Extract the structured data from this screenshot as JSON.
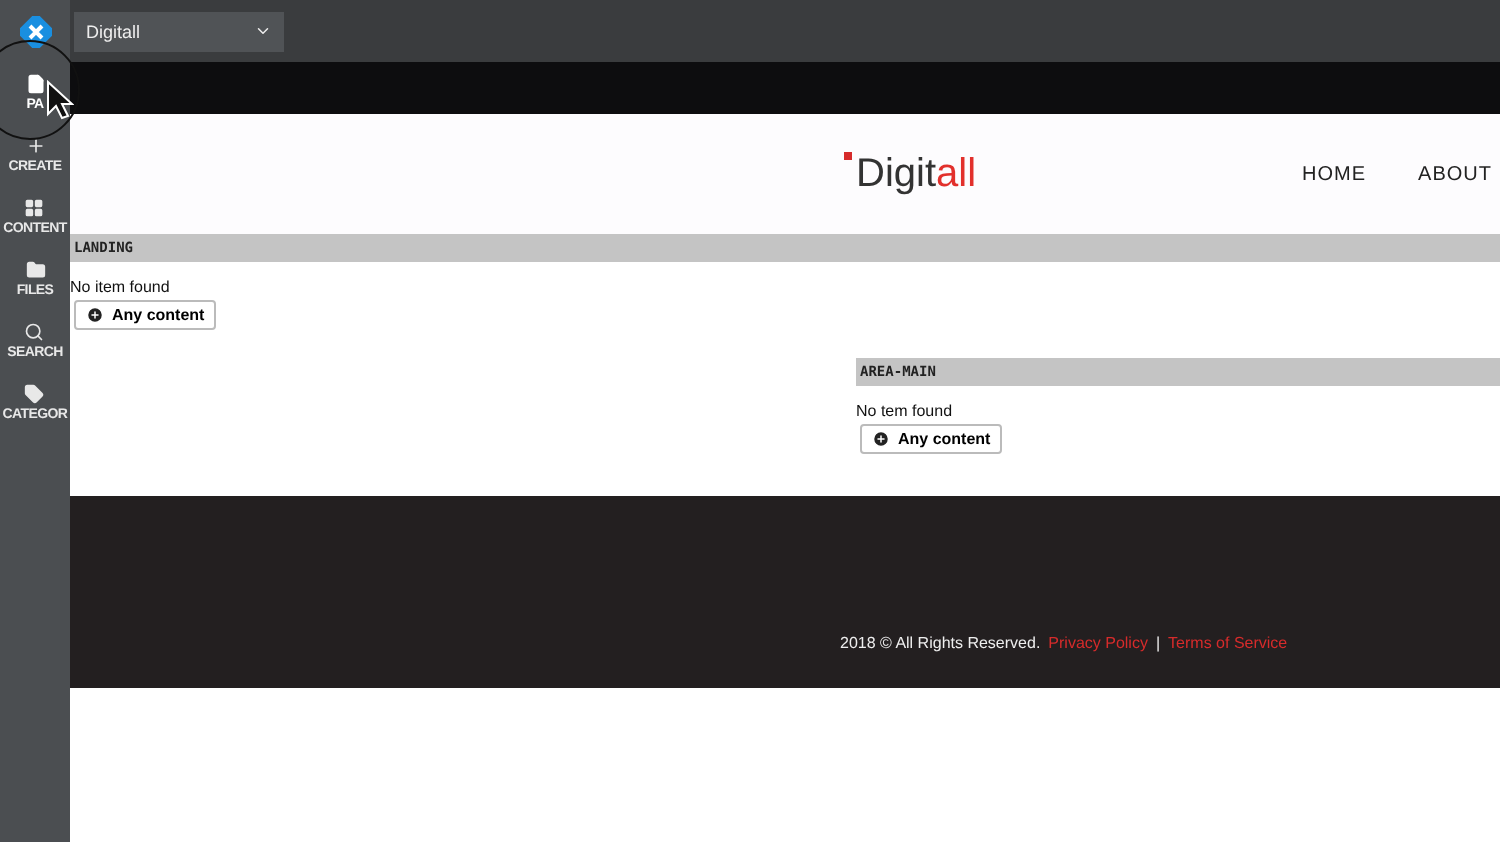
{
  "site_selector": {
    "value": "Digitall"
  },
  "sidebar": {
    "items": [
      {
        "label": "PA",
        "selected": true
      },
      {
        "label": "CREATE",
        "selected": false
      },
      {
        "label": "CONTENT",
        "selected": false
      },
      {
        "label": "FILES",
        "selected": false
      },
      {
        "label": "SEARCH",
        "selected": false
      },
      {
        "label": "CATEGOR",
        "selected": false
      }
    ]
  },
  "header": {
    "logo": {
      "dark": "Digit",
      "accent": "all"
    },
    "nav": [
      "HOME",
      "ABOUT"
    ]
  },
  "areas": [
    {
      "title": "LANDING",
      "empty_text": "No item found",
      "button": "Any content"
    },
    {
      "title": "AREA-MAIN",
      "empty_text": "No tem found",
      "button": "Any content"
    }
  ],
  "footer": {
    "copyright": "2018 © All Rights Reserved.",
    "links": [
      "Privacy Policy",
      "Terms of Service"
    ],
    "separator": "|"
  }
}
